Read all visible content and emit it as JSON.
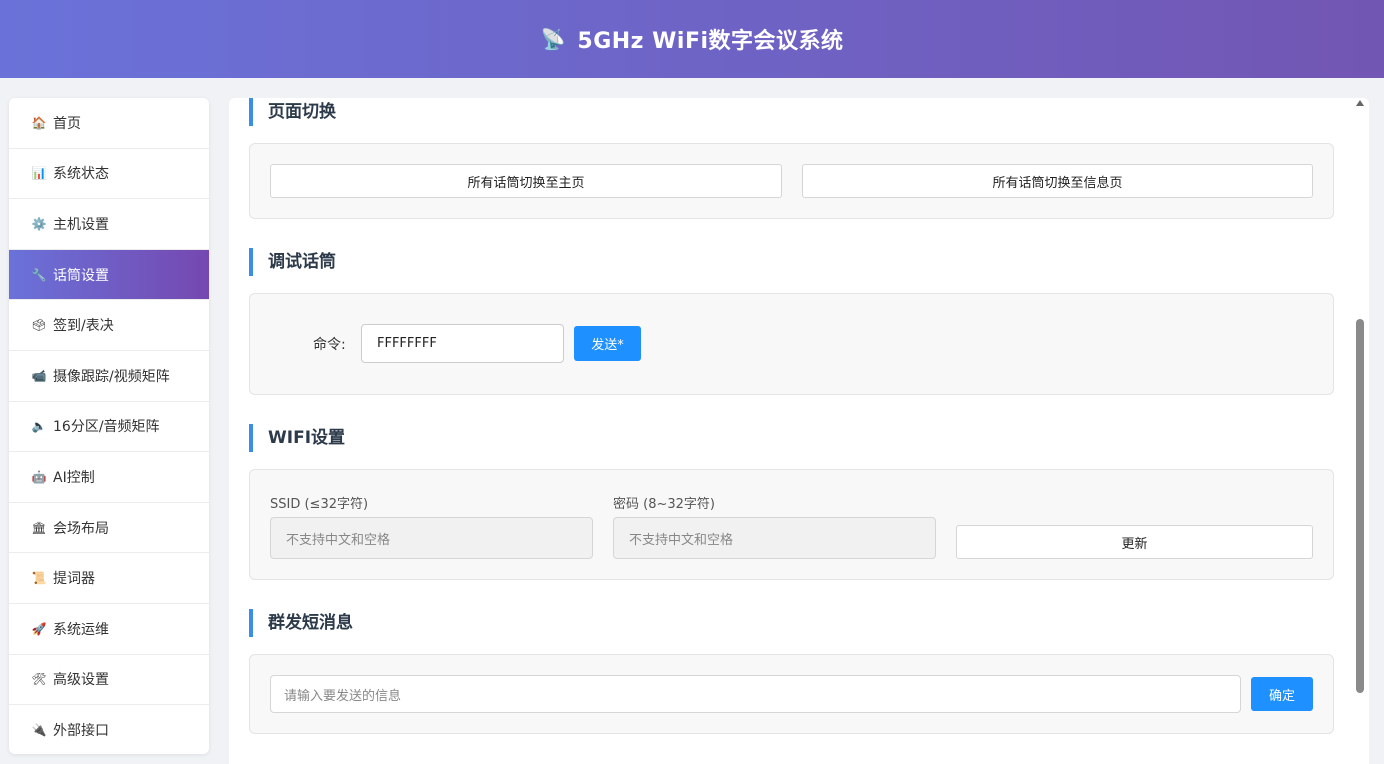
{
  "header": {
    "logo_icon": "📡",
    "title": "5GHz WiFi数字会议系统"
  },
  "sidebar": {
    "items": [
      {
        "icon": "🏠",
        "label": "首页"
      },
      {
        "icon": "📊",
        "label": "系统状态"
      },
      {
        "icon": "⚙️",
        "label": "主机设置"
      },
      {
        "icon": "🔧",
        "label": "话筒设置"
      },
      {
        "icon": "🗳",
        "label": "签到/表决"
      },
      {
        "icon": "📹",
        "label": "摄像跟踪/视频矩阵"
      },
      {
        "icon": "🔈",
        "label": "16分区/音频矩阵"
      },
      {
        "icon": "🤖",
        "label": "AI控制"
      },
      {
        "icon": "🏛",
        "label": "会场布局"
      },
      {
        "icon": "📜",
        "label": "提词器"
      },
      {
        "icon": "🚀",
        "label": "系统运维"
      },
      {
        "icon": "🛠",
        "label": "高级设置"
      },
      {
        "icon": "🔌",
        "label": "外部接口"
      }
    ],
    "active_index": 3
  },
  "page_switch": {
    "title": "页面切换",
    "btn_home": "所有话筒切换至主页",
    "btn_info": "所有话筒切换至信息页"
  },
  "debug_mic": {
    "title": "调试话筒",
    "command_label": "命令:",
    "command_value": "FFFFFFFF",
    "send_label": "发送*"
  },
  "wifi": {
    "title": "WIFI设置",
    "ssid_label": "SSID (≤32字符)",
    "ssid_placeholder": "不支持中文和空格",
    "password_label": "密码 (8~32字符)",
    "password_placeholder": "不支持中文和空格",
    "update_label": "更新"
  },
  "broadcast": {
    "title": "群发短消息",
    "placeholder": "请输入要发送的信息",
    "confirm_label": "确定"
  },
  "colors": {
    "header_start": "#6a72d9",
    "header_end": "#7256b3",
    "accent_blue": "#1e90ff",
    "section_bar": "#3a8ee6"
  }
}
